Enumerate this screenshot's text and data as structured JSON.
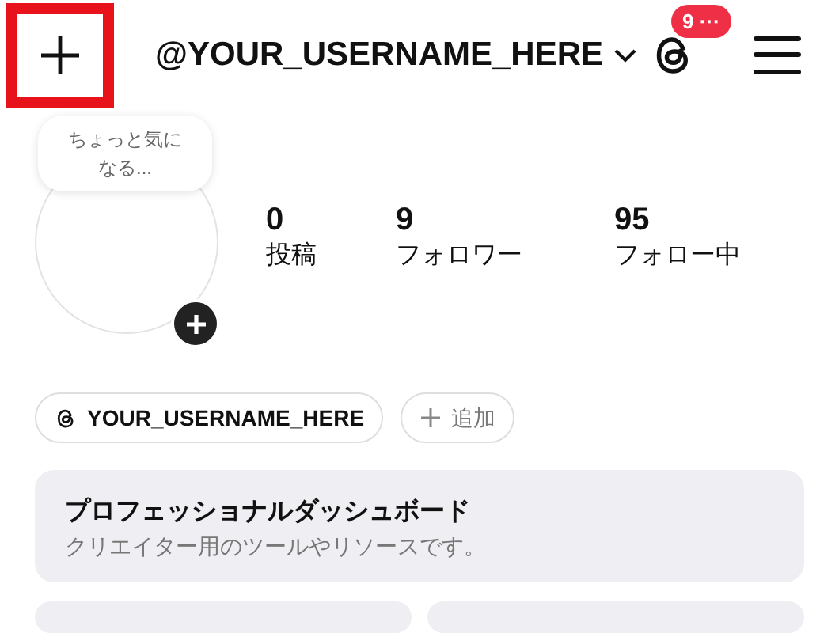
{
  "header": {
    "create_button": {
      "highlighted": true
    },
    "username": "@YOUR_USERNAME_HERE",
    "notification_badge": "9 ···"
  },
  "profile": {
    "note": "ちょっと気になる...",
    "stats": [
      {
        "value": "0",
        "label": "投稿"
      },
      {
        "value": "9",
        "label": "フォロワー"
      },
      {
        "value": "95",
        "label": "フォロー中"
      }
    ]
  },
  "chips": [
    {
      "kind": "threads",
      "label": "YOUR_USERNAME_HERE"
    },
    {
      "kind": "add",
      "label": "追加"
    }
  ],
  "dashboard": {
    "title": "プロフェッショナルダッシュボード",
    "subtitle": "クリエイター用のツールやリソースです。"
  }
}
